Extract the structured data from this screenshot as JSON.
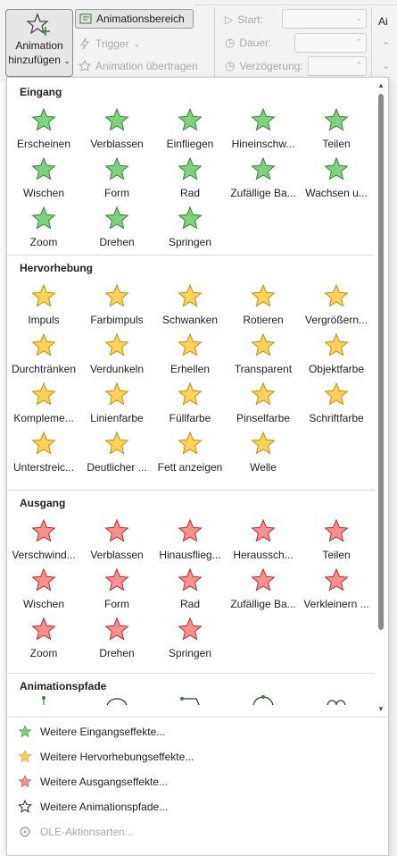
{
  "ribbon": {
    "add_animation_line1": "Animation",
    "add_animation_line2": "hinzufügen",
    "animation_area": "Animationsbereich",
    "trigger": "Trigger",
    "animation_painter": "Animation übertragen",
    "start_label": "Start:",
    "duration_label": "Dauer:",
    "delay_label": "Verzögerung:",
    "right_edge": "Ai"
  },
  "sections": [
    {
      "title": "Eingang",
      "kind": "entrance",
      "items": [
        "Erscheinen",
        "Verblassen",
        "Einfliegen",
        "Hineinschw...",
        "Teilen",
        "Wischen",
        "Form",
        "Rad",
        "Zufällige Ba...",
        "Wachsen u...",
        "Zoom",
        "Drehen",
        "Springen"
      ]
    },
    {
      "title": "Hervorhebung",
      "kind": "emphasis",
      "items": [
        "Impuls",
        "Farbimpuls",
        "Schwanken",
        "Rotieren",
        "Vergrößern...",
        "Durchtränken",
        "Verdunkeln",
        "Erhellen",
        "Transparent",
        "Objektfarbe",
        "Kompleme...",
        "Linienfarbe",
        "Füllfarbe",
        "Pinselfarbe",
        "Schriftfarbe",
        "Unterstreic...",
        "Deutlicher ...",
        "Fett anzeigen",
        "Welle"
      ]
    },
    {
      "title": "Ausgang",
      "kind": "exit",
      "items": [
        "Verschwind...",
        "Verblassen",
        "Hinausflieg...",
        "Heraussch...",
        "Teilen",
        "Wischen",
        "Form",
        "Rad",
        "Zufällige Ba...",
        "Verkleinern ...",
        "Zoom",
        "Drehen",
        "Springen"
      ]
    },
    {
      "title": "Animationspfade",
      "kind": "path",
      "items": []
    }
  ],
  "menu": [
    {
      "label": "Weitere Eingangseffekte...",
      "icon": "green-star-icon",
      "disabled": false
    },
    {
      "label": "Weitere Hervorhebungseffekte...",
      "icon": "gold-star-icon",
      "disabled": false
    },
    {
      "label": "Weitere Ausgangseffekte...",
      "icon": "red-star-icon",
      "disabled": false
    },
    {
      "label": "Weitere Animationspfade...",
      "icon": "outline-star-icon",
      "disabled": false
    },
    {
      "label": "OLE-Aktionsarten...",
      "icon": "gear-icon",
      "disabled": true
    }
  ],
  "colors": {
    "entrance": "#5cb85c",
    "emphasis": "#f0b030",
    "exit": "#e05050",
    "accent": "#2e7d32"
  }
}
